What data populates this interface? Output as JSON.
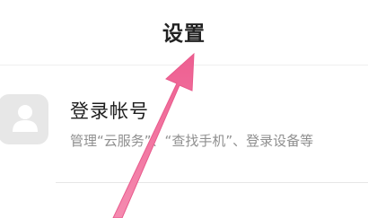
{
  "header": {
    "title": "设置"
  },
  "account": {
    "title": "登录帐号",
    "subtitle": "管理“云服务”、“查找手机”、登录设备等",
    "avatar_icon": "user-avatar-icon"
  },
  "annotation": {
    "arrow_color": "#f0709a",
    "arrow_icon": "pointer-arrow"
  }
}
